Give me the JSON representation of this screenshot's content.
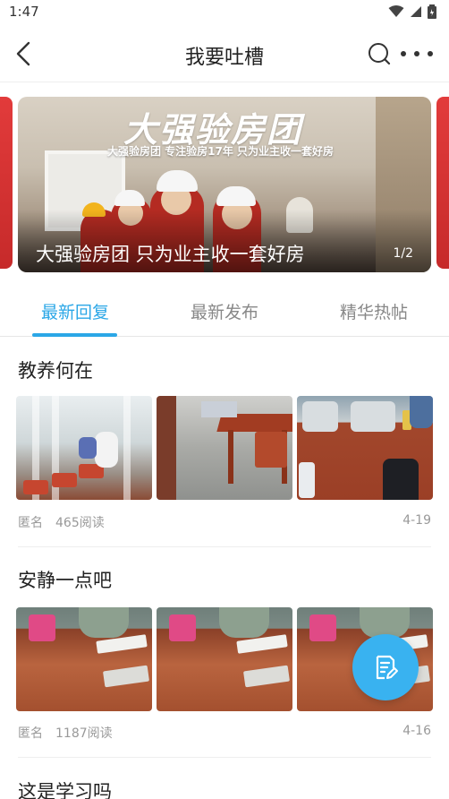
{
  "status_bar": {
    "time": "1:47"
  },
  "header": {
    "title": "我要吐槽"
  },
  "banner": {
    "brand_text": "大强验房团",
    "subline": "大强验房团 专注验房17年 只为业主收一套好房",
    "caption": "大强验房团 只为业主收一套好房",
    "page_indicator": "1/2"
  },
  "tabs": [
    {
      "label": "最新回复",
      "active": true
    },
    {
      "label": "最新发布",
      "active": false
    },
    {
      "label": "精华热帖",
      "active": false
    }
  ],
  "posts": [
    {
      "title": "教养何在",
      "author": "匿名",
      "reads": "465阅读",
      "date": "4-19"
    },
    {
      "title": "安静一点吧",
      "author": "匿名",
      "reads": "1187阅读",
      "date": "4-16"
    },
    {
      "title": "这是学习吗"
    }
  ],
  "colors": {
    "accent": "#2ba7e7",
    "fab": "#39b2f0",
    "muted": "#999999"
  },
  "icons": {
    "back": "back-arrow-icon",
    "search": "search-icon",
    "more": "more-dots-icon",
    "fab": "edit-note-icon"
  }
}
